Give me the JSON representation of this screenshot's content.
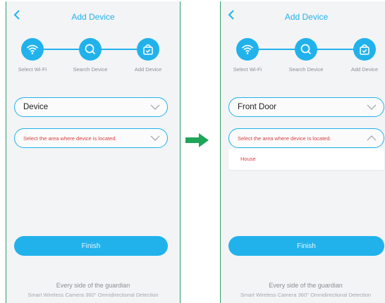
{
  "screens": [
    {
      "header": {
        "title": "Add Device"
      },
      "steps": [
        {
          "label": "Select Wi-Fi",
          "icon": "wifi-icon"
        },
        {
          "label": "Search Device",
          "icon": "search-icon"
        },
        {
          "label": "Add Device",
          "icon": "bag-check-icon"
        }
      ],
      "name_field": {
        "value": "Device"
      },
      "area_field": {
        "placeholder": "Select the area where device is located.",
        "expanded": false
      },
      "finish_label": "Finish",
      "footer": {
        "tagline": "Every side of the guardian",
        "subtitle": "Smart Wireless Camera 360° Omnidirectional Detection"
      }
    },
    {
      "header": {
        "title": "Add Device"
      },
      "steps": [
        {
          "label": "Select Wi-Fi",
          "icon": "wifi-icon"
        },
        {
          "label": "Search Device",
          "icon": "search-icon"
        },
        {
          "label": "Add Device",
          "icon": "bag-check-icon"
        }
      ],
      "name_field": {
        "value": "Front Door"
      },
      "area_field": {
        "placeholder": "Select the area where device is located.",
        "expanded": true,
        "options": [
          "House"
        ]
      },
      "finish_label": "Finish",
      "footer": {
        "tagline": "Every side of the guardian",
        "subtitle": "Smart Wireless Camera 360° Omnidirectional Detection"
      }
    }
  ],
  "colors": {
    "accent": "#21b2ec",
    "placeholder_red": "#d94040",
    "arrow_green": "#1fa55a",
    "screen_bg": "#f3f4f6"
  }
}
